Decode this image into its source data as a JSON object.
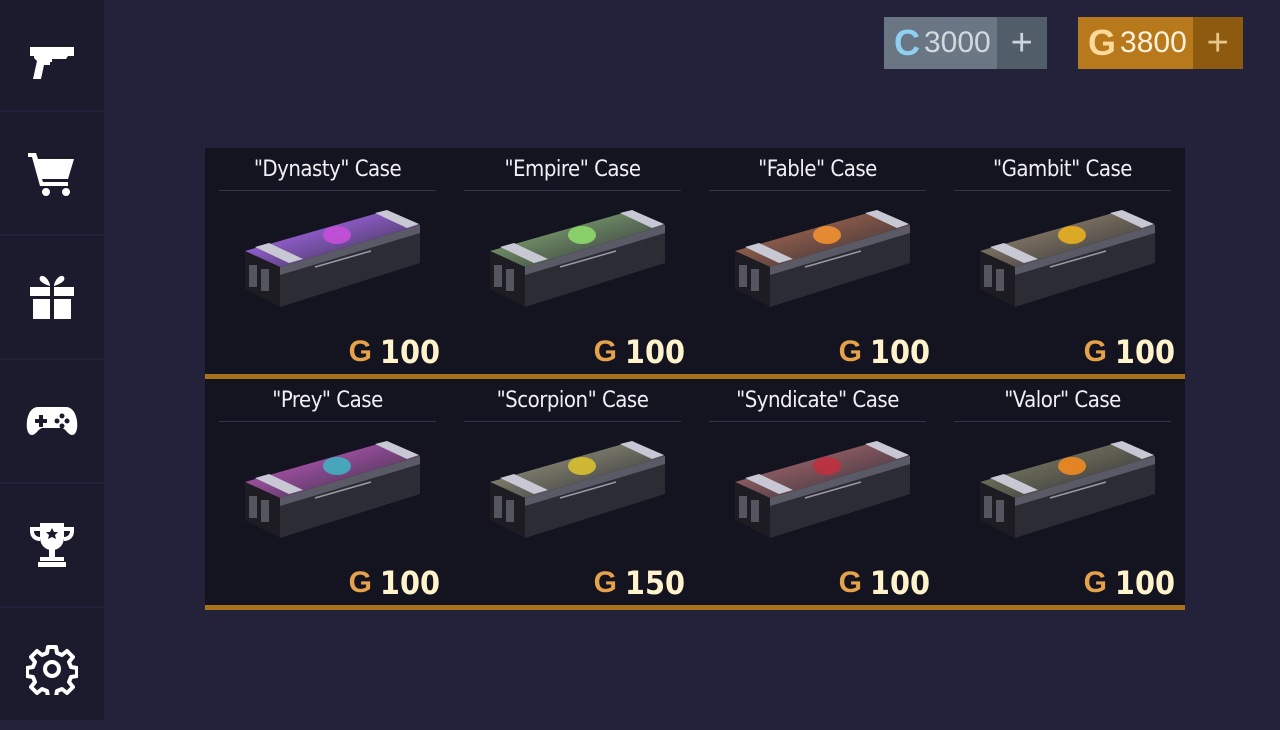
{
  "sidebar": {
    "items": [
      {
        "name": "pistol-icon"
      },
      {
        "name": "cart-icon"
      },
      {
        "name": "gift-icon"
      },
      {
        "name": "gamepad-icon"
      },
      {
        "name": "trophy-icon"
      },
      {
        "name": "gear-icon"
      }
    ]
  },
  "currency": {
    "silver": {
      "glyph": "C",
      "amount": "3000",
      "plus": "+"
    },
    "gold": {
      "glyph": "G",
      "amount": "3800",
      "plus": "+"
    }
  },
  "cases": [
    {
      "title": "\"Dynasty\" Case",
      "label": "DYNASTY",
      "price_glyph": "G",
      "price": "100",
      "tint": "#8e5cc9",
      "emblem": "#c64fd8"
    },
    {
      "title": "\"Empire\" Case",
      "label": "EMPIRE",
      "price_glyph": "G",
      "price": "100",
      "tint": "#6e8a64",
      "emblem": "#8ed86a"
    },
    {
      "title": "\"Fable\" Case",
      "label": "FABLE",
      "price_glyph": "G",
      "price": "100",
      "tint": "#8a5a4a",
      "emblem": "#f09030"
    },
    {
      "title": "\"Gambit\" Case",
      "label": "GAMBIT",
      "price_glyph": "G",
      "price": "100",
      "tint": "#7a7060",
      "emblem": "#e8b020"
    },
    {
      "title": "\"Prey\" Case",
      "label": "",
      "price_glyph": "G",
      "price": "100",
      "tint": "#9a4e9e",
      "emblem": "#40b0c0"
    },
    {
      "title": "\"Scorpion\" Case",
      "label": "SCORPION",
      "price_glyph": "G",
      "price": "150",
      "tint": "#7a7a6a",
      "emblem": "#d8c030"
    },
    {
      "title": "\"Syndicate\" Case",
      "label": "SYNDICATE",
      "price_glyph": "G",
      "price": "100",
      "tint": "#8a5a60",
      "emblem": "#c03040"
    },
    {
      "title": "\"Valor\" Case",
      "label": "VALOR",
      "price_glyph": "G",
      "price": "100",
      "tint": "#6a6a58",
      "emblem": "#f08a20"
    }
  ]
}
